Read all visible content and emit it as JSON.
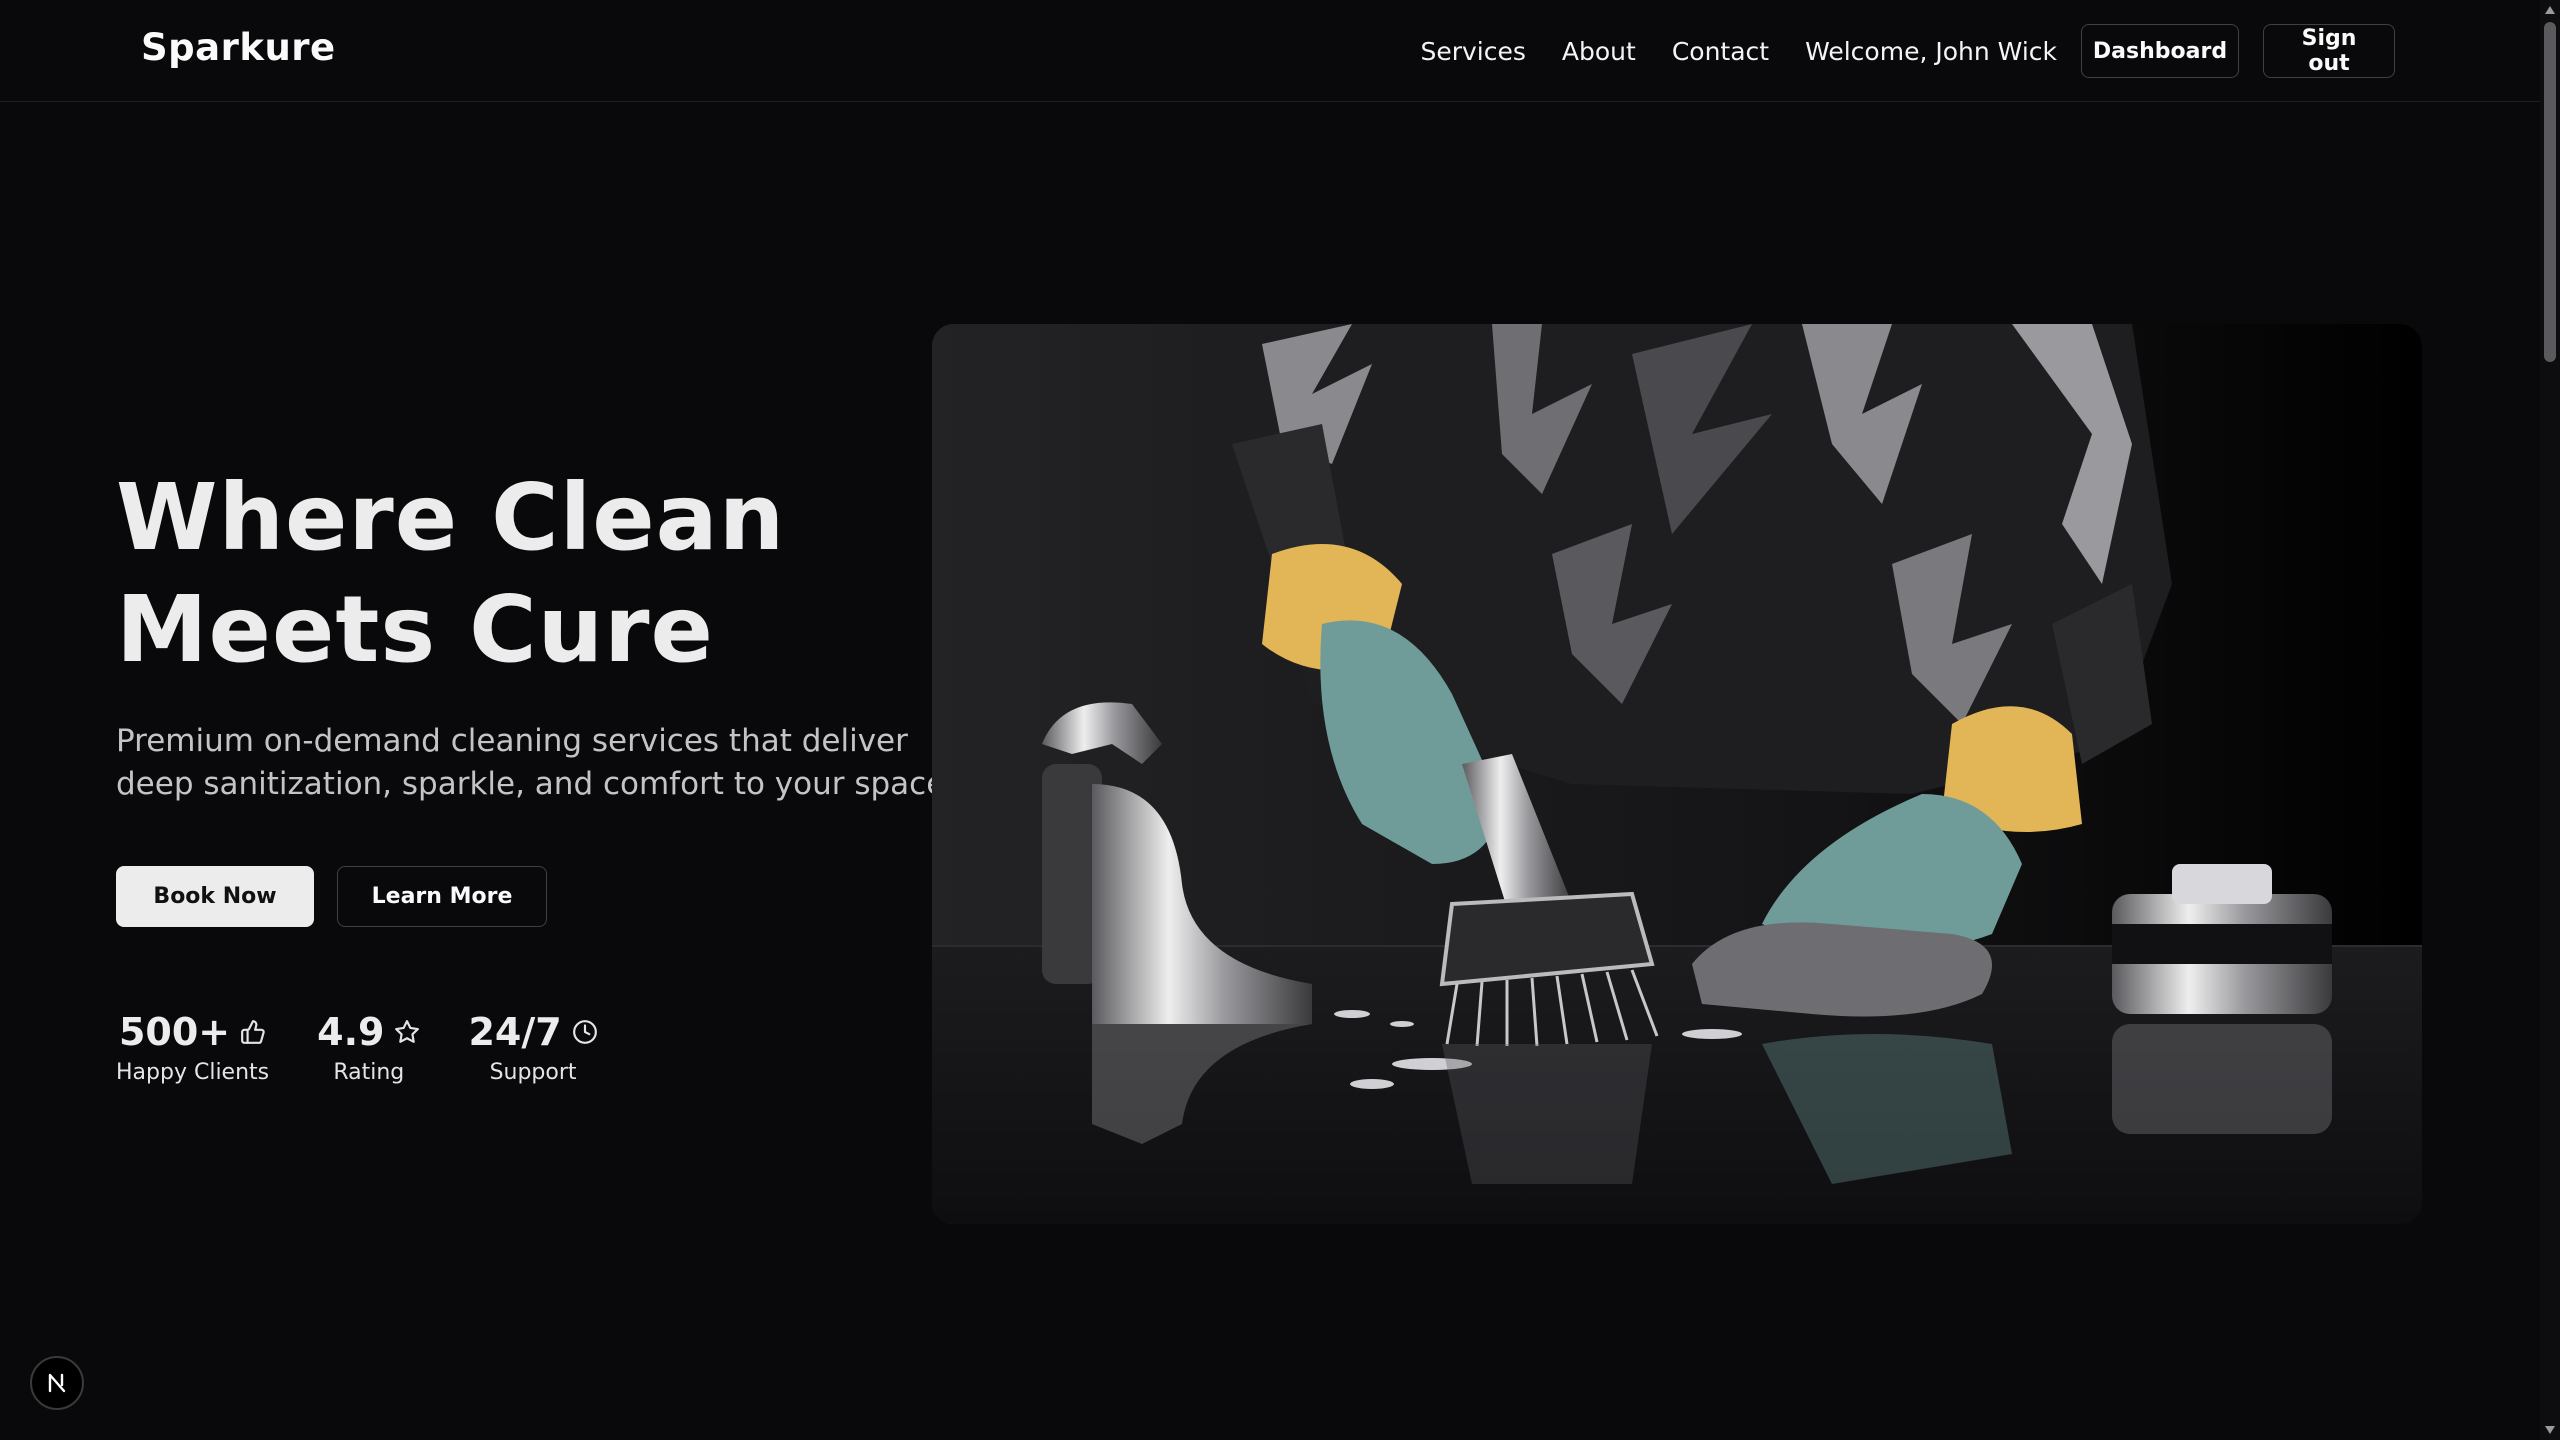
{
  "header": {
    "brand": "Sparkure",
    "nav": [
      "Services",
      "About",
      "Contact"
    ],
    "welcome": "Welcome, John Wick",
    "dashboard_label": "Dashboard",
    "signout_label": "Sign out"
  },
  "hero": {
    "title_line1": "Where Clean",
    "title_line2": "Meets Cure",
    "subtitle_line1": "Premium on-demand cleaning services that deliver",
    "subtitle_line2": "deep sanitization, sparkle, and comfort to your space.",
    "book_label": "Book Now",
    "learn_label": "Learn More"
  },
  "stats": [
    {
      "value": "500+",
      "label": "Happy Clients",
      "icon": "thumbs-up-icon"
    },
    {
      "value": "4.9",
      "label": "Rating",
      "icon": "star-icon"
    },
    {
      "value": "24/7",
      "label": "Support",
      "icon": "clock-icon"
    }
  ],
  "image": {
    "subject": "cleaning-illustration"
  },
  "badge": {
    "letter": "N"
  },
  "colors": {
    "background": "#09090b",
    "primary_button": "#ececec",
    "border": "#3f3f46",
    "glove": "#6f9c99",
    "cuff": "#e2b556"
  }
}
